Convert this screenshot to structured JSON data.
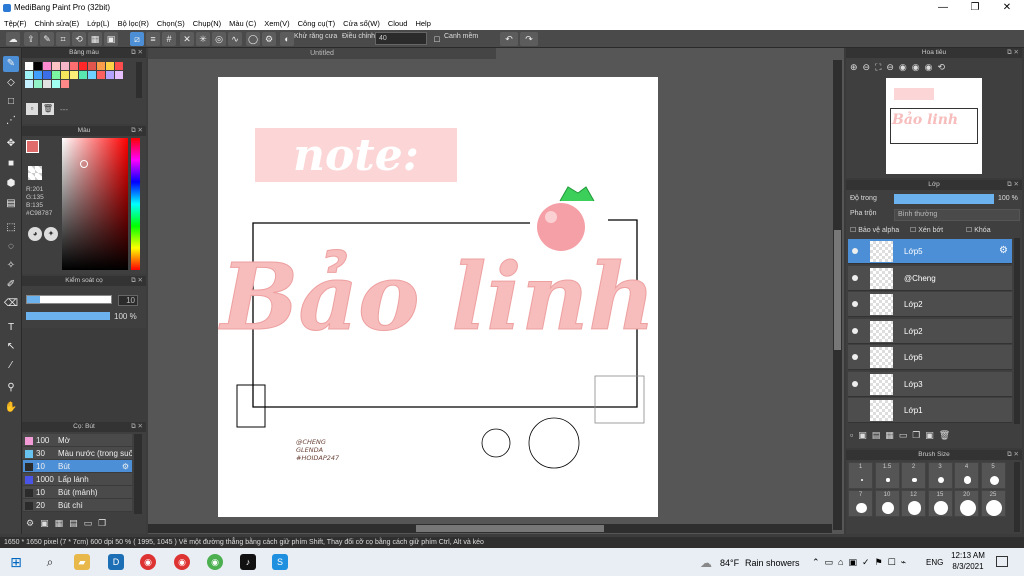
{
  "window": {
    "title": "MediBang Paint Pro (32bit)",
    "minimize": "—",
    "maximize": "❐",
    "close": "✕"
  },
  "menu": [
    "Tệp(F)",
    "Chỉnh sửa(E)",
    "Lớp(L)",
    "Bộ lọc(R)",
    "Chọn(S)",
    "Chụp(N)",
    "Màu (C)",
    "Xem(V)",
    "Công cụ(T)",
    "Cửa sổ(W)",
    "Cloud",
    "Help"
  ],
  "toolbar": {
    "antialias_label": "Khử răng cưa",
    "adjust_label": "Điều chỉnh",
    "adjust_value": "40",
    "smooth_label": "Canh mềm",
    "undo": "↶",
    "redo": "↷"
  },
  "panels": {
    "palette_title": "Bảng màu",
    "palette_more": "---",
    "color_title": "Màu",
    "color_values": {
      "r": "R:201",
      "g": "G:135",
      "b": "B:135",
      "hex": "#C98787"
    },
    "control_title": "Kiểm soát cọ",
    "brush_size_value": "10",
    "opacity_value": "100 %",
    "brush_title": "Cọ: Bút",
    "brushes": [
      {
        "size": "100",
        "name": "Mờ",
        "color": "#f29bd6"
      },
      {
        "size": "30",
        "name": "Màu nước (trong suốt)",
        "color": "#67c2f0"
      },
      {
        "size": "10",
        "name": "Bút",
        "color": "#2b2b2b"
      },
      {
        "size": "1000",
        "name": "Lấp lánh",
        "color": "#4a55e8"
      },
      {
        "size": "10",
        "name": "Bút (mảnh)",
        "color": "#2b2b2b"
      },
      {
        "size": "20",
        "name": "Bút chì",
        "color": "#2b2b2b"
      }
    ]
  },
  "document": {
    "tab_title": "Untitled",
    "note_text": "note:",
    "main_text": "Bảo linh",
    "credit_lines": [
      "@CHENG",
      "GLENDA",
      "#HOIDAP247"
    ]
  },
  "navigator": {
    "title": "Hoa tiêu"
  },
  "layer_panel": {
    "title": "Lớp",
    "opacity_label": "Độ trong",
    "opacity_value": "100 %",
    "opacity_fraction": 1.0,
    "blend_label": "Pha trộn",
    "blend_value": "Bình thường",
    "protect_alpha": "Bảo vệ alpha",
    "clipping": "Xén bớt",
    "lock": "Khóa",
    "layers": [
      {
        "name": "Lớp5",
        "selected": true,
        "visible": true
      },
      {
        "name": "@Cheng",
        "selected": false,
        "visible": true
      },
      {
        "name": "Lớp2",
        "selected": false,
        "visible": true
      },
      {
        "name": "Lớp2",
        "selected": false,
        "visible": true
      },
      {
        "name": "Lớp6",
        "selected": false,
        "visible": true
      },
      {
        "name": "Lớp3",
        "selected": false,
        "visible": true
      },
      {
        "name": "Lớp1",
        "selected": false,
        "visible": false
      }
    ]
  },
  "brush_size_panel": {
    "title": "Brush Size",
    "row1": [
      "1",
      "1.5",
      "2",
      "3",
      "4",
      "5"
    ],
    "row2": [
      "7",
      "10",
      "12",
      "15",
      "20",
      "25"
    ]
  },
  "status": {
    "text": "1650 * 1650 pixel   (7 * 7cm)   600 dpi   50 %   ( 1995, 1045 )   Vẽ một đường thẳng bằng cách giữ phím Shift, Thay đổi cỡ cọ bằng cách giữ phím Ctrl, Alt và kéo"
  },
  "taskbar": {
    "weather_temp": "84°F",
    "weather_text": "Rain showers",
    "lang": "ENG",
    "time": "12:13 AM",
    "date": "8/3/2021"
  },
  "colors": {
    "accent": "#4c8fd6",
    "pink_text": "#f7bcbc",
    "note_bg": "#fcd6d6"
  }
}
